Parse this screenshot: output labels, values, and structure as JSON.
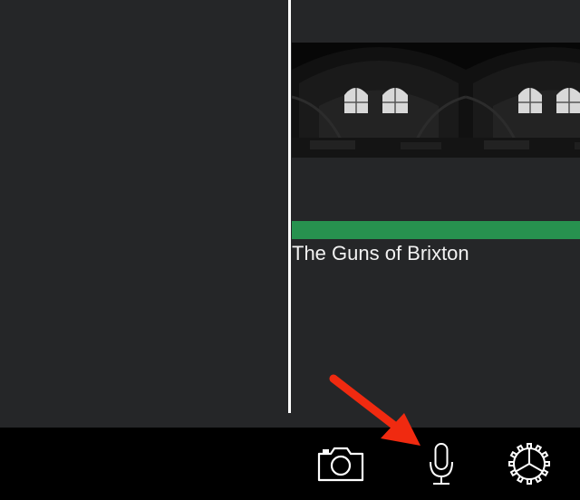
{
  "timeline": {
    "audio_clip_title": "The Guns of Brixton"
  },
  "toolbar": {
    "buttons": [
      {
        "name": "camera",
        "icon": "camera-icon"
      },
      {
        "name": "voiceover",
        "icon": "microphone-icon"
      },
      {
        "name": "settings",
        "icon": "gear-icon"
      }
    ]
  },
  "annotation": {
    "arrow_color": "#f02a10"
  },
  "colors": {
    "background": "#252628",
    "audio_track": "#27924f",
    "toolbar": "#000000",
    "playhead": "#ffffff"
  }
}
